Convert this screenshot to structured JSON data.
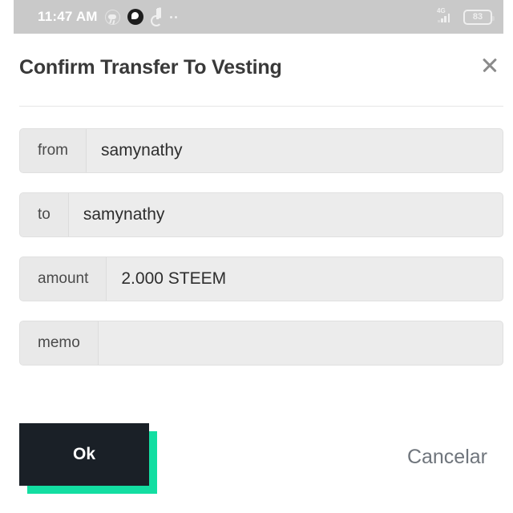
{
  "status_bar": {
    "time": "11:47 AM",
    "left_icons": [
      {
        "name": "weather-icon",
        "glyph": "weather"
      },
      {
        "name": "messaging-circle-icon",
        "glyph": "circle-dark"
      },
      {
        "name": "tiktok-icon",
        "glyph": "tiktok"
      },
      {
        "name": "more-notifications-icon",
        "glyph": "dots"
      }
    ],
    "network_type": "4G",
    "signal_icon": "signal-bars-icon",
    "battery_level": "83",
    "battery_icon": "battery-icon",
    "background_color": "#c9c9c9"
  },
  "dialog": {
    "title": "Confirm Transfer To Vesting",
    "close_icon": "close-icon",
    "fields": [
      {
        "label": "from",
        "value": "samynathy"
      },
      {
        "label": "to",
        "value": "samynathy"
      },
      {
        "label": "amount",
        "value": "2.000 STEEM"
      },
      {
        "label": "memo",
        "value": ""
      }
    ],
    "actions": {
      "confirm_label": "Ok",
      "cancel_label": "Cancelar"
    },
    "colors": {
      "confirm_background": "#1a2027",
      "confirm_shadow": "#13dea2",
      "cancel_text": "#6f757c",
      "title_text": "#393939",
      "field_background": "#ececec",
      "field_label_background": "#e9e9e9"
    }
  }
}
